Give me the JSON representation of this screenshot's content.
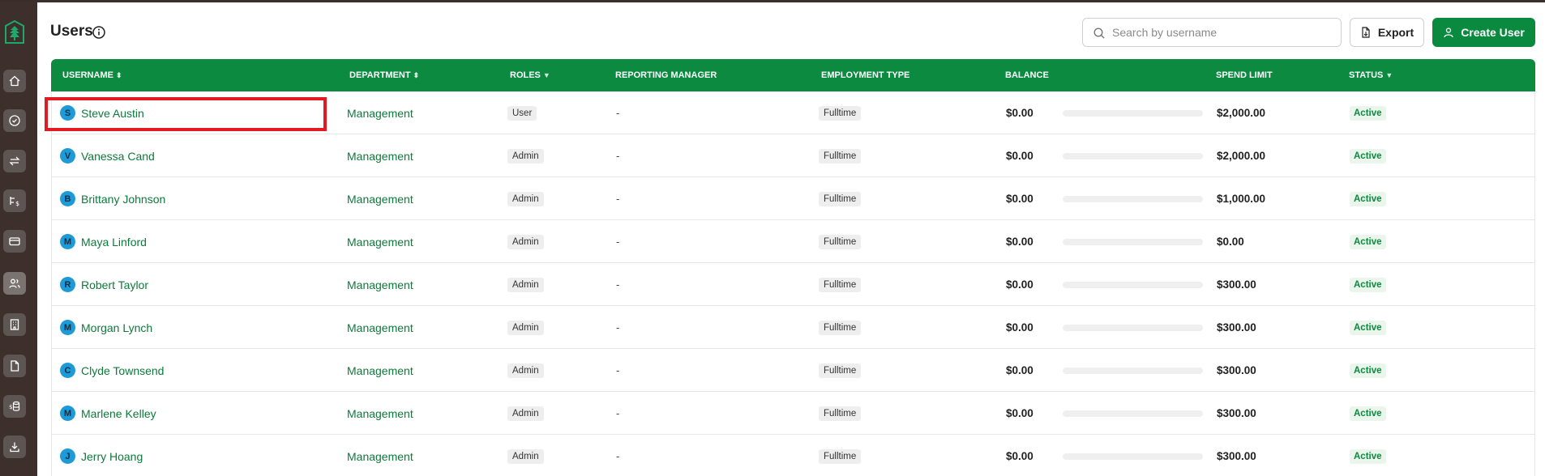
{
  "page": {
    "title": "Users",
    "search_placeholder": "Search by username",
    "export_label": "Export",
    "create_label": "Create User"
  },
  "sidebar": {
    "items": [
      {
        "icon": "home-icon"
      },
      {
        "icon": "check-circle-icon"
      },
      {
        "icon": "transfer-icon"
      },
      {
        "icon": "payments-icon"
      },
      {
        "icon": "card-icon"
      },
      {
        "icon": "users-icon",
        "active": true
      },
      {
        "icon": "building-icon"
      },
      {
        "icon": "document-icon"
      },
      {
        "icon": "funds-icon"
      },
      {
        "icon": "download-icon"
      }
    ]
  },
  "table": {
    "headers": {
      "username": "USERNAME",
      "department": "DEPARTMENT",
      "roles": "ROLES",
      "manager": "REPORTING MANAGER",
      "employment": "EMPLOYMENT TYPE",
      "balance": "BALANCE",
      "spend": "SPEND LIMIT",
      "status": "STATUS"
    },
    "rows": [
      {
        "initial": "S",
        "name": "Steve Austin",
        "dept": "Management",
        "role": "User",
        "manager": "-",
        "emp": "Fulltime",
        "balance": "$0.00",
        "usage": 0,
        "limit": "$2,000.00",
        "status": "Active"
      },
      {
        "initial": "V",
        "name": "Vanessa Cand",
        "dept": "Management",
        "role": "Admin",
        "manager": "-",
        "emp": "Fulltime",
        "balance": "$0.00",
        "usage": 0,
        "limit": "$2,000.00",
        "status": "Active"
      },
      {
        "initial": "B",
        "name": "Brittany Johnson",
        "dept": "Management",
        "role": "Admin",
        "manager": "-",
        "emp": "Fulltime",
        "balance": "$0.00",
        "usage": 0,
        "limit": "$1,000.00",
        "status": "Active"
      },
      {
        "initial": "M",
        "name": "Maya Linford",
        "dept": "Management",
        "role": "Admin",
        "manager": "-",
        "emp": "Fulltime",
        "balance": "$0.00",
        "usage": 0,
        "limit": "$0.00",
        "status": "Active"
      },
      {
        "initial": "R",
        "name": "Robert Taylor",
        "dept": "Management",
        "role": "Admin",
        "manager": "-",
        "emp": "Fulltime",
        "balance": "$0.00",
        "usage": 0,
        "limit": "$300.00",
        "status": "Active"
      },
      {
        "initial": "M",
        "name": "Morgan Lynch",
        "dept": "Management",
        "role": "Admin",
        "manager": "-",
        "emp": "Fulltime",
        "balance": "$0.00",
        "usage": 0,
        "limit": "$300.00",
        "status": "Active"
      },
      {
        "initial": "C",
        "name": "Clyde Townsend",
        "dept": "Management",
        "role": "Admin",
        "manager": "-",
        "emp": "Fulltime",
        "balance": "$0.00",
        "usage": 0,
        "limit": "$300.00",
        "status": "Active"
      },
      {
        "initial": "M",
        "name": "Marlene Kelley",
        "dept": "Management",
        "role": "Admin",
        "manager": "-",
        "emp": "Fulltime",
        "balance": "$0.00",
        "usage": 0,
        "limit": "$300.00",
        "status": "Active"
      },
      {
        "initial": "J",
        "name": "Jerry Hoang",
        "dept": "Management",
        "role": "Admin",
        "manager": "-",
        "emp": "Fulltime",
        "balance": "$0.00",
        "usage": 0,
        "limit": "$300.00",
        "status": "Active"
      }
    ]
  },
  "colors": {
    "brand": "#0a8a3f",
    "sidebar": "#3d302c",
    "avatar": "#1e9ad6",
    "highlight": "#e11b22"
  }
}
